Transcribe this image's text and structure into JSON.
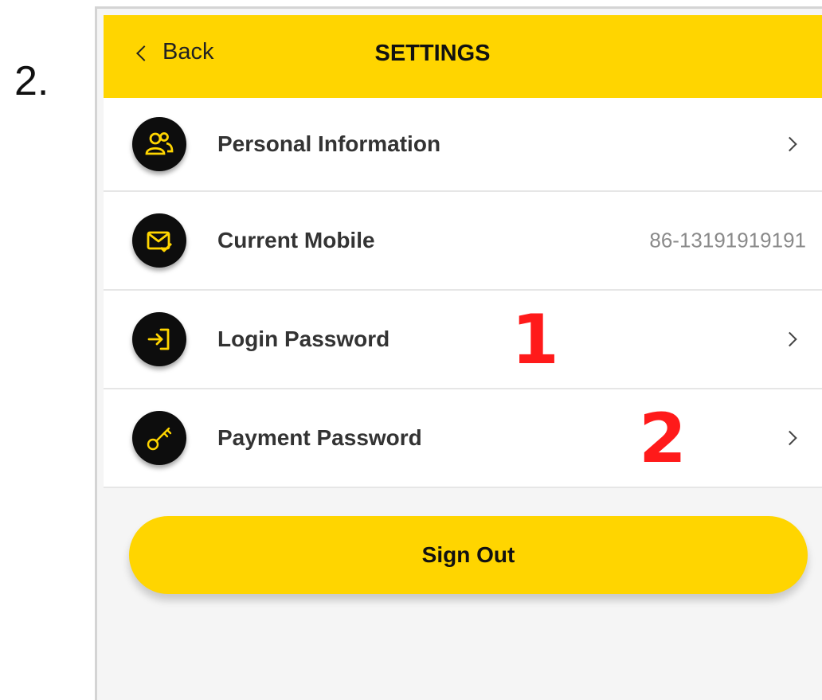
{
  "step_label": "2.",
  "header": {
    "back_label": "Back",
    "title": "SETTINGS"
  },
  "settings_items": [
    {
      "label": "Personal Information",
      "icon": "user-group-icon"
    },
    {
      "label": "Current Mobile",
      "icon": "phone-check-icon",
      "value": "86-13191919191"
    },
    {
      "label": "Login Password",
      "icon": "login-icon"
    },
    {
      "label": "Payment Password",
      "icon": "key-icon"
    }
  ],
  "annotations": [
    "1",
    "2"
  ],
  "signout_label": "Sign Out",
  "colors": {
    "accent": "#FFD500",
    "icon_bg": "#0d0d0d",
    "annotation": "#ff1a1a"
  }
}
